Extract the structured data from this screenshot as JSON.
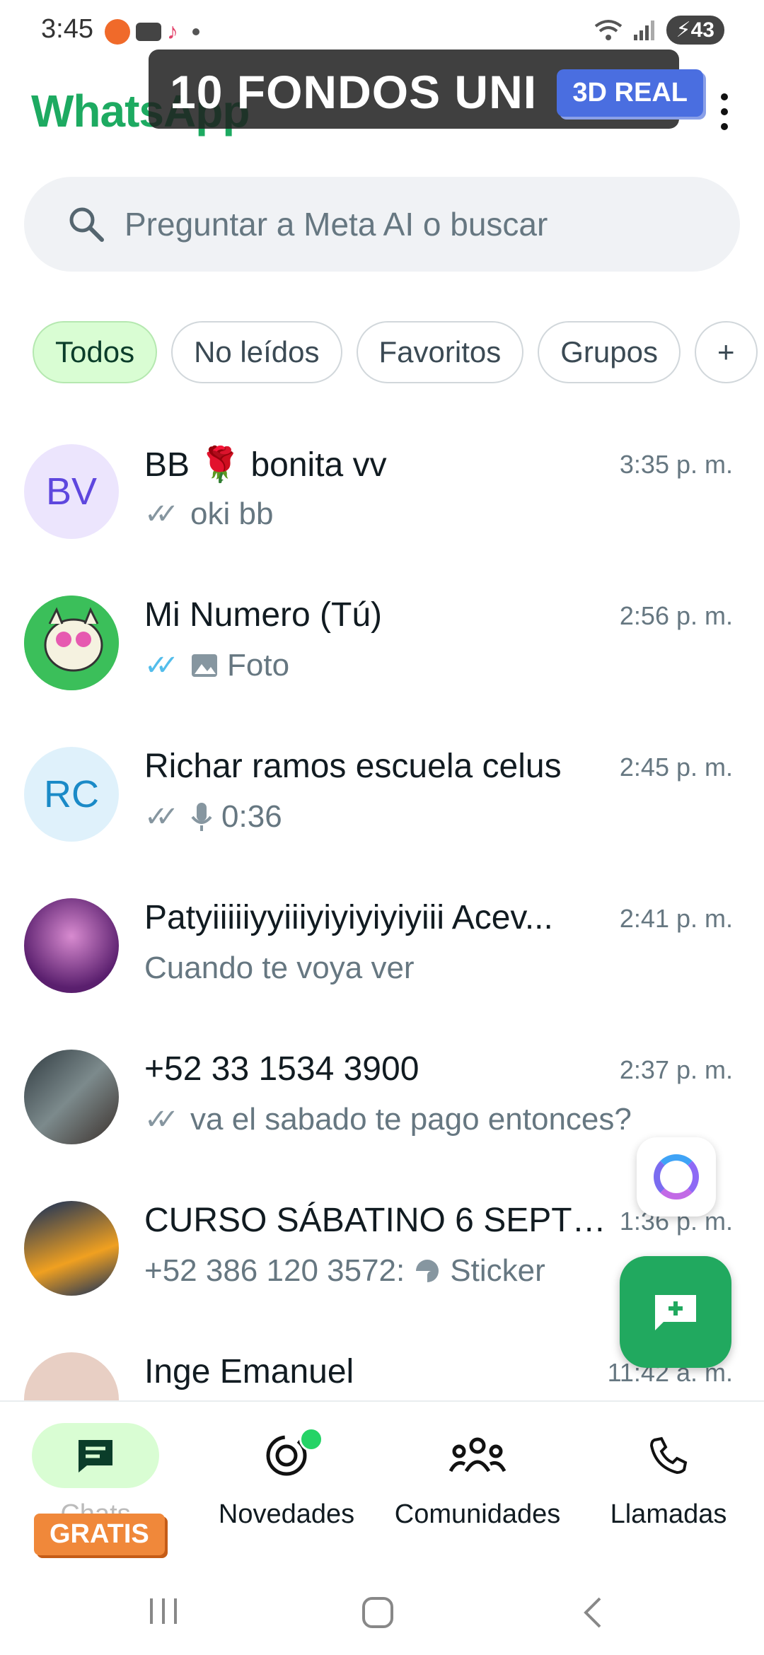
{
  "status_bar": {
    "time": "3:45",
    "battery": "43"
  },
  "header": {
    "title": "WhatsApp"
  },
  "overlay": {
    "text": "10 FONDOS UNI",
    "badge": "3D REAL"
  },
  "search": {
    "placeholder": "Preguntar a Meta AI o buscar"
  },
  "filters": [
    {
      "label": "Todos",
      "active": true
    },
    {
      "label": "No leídos"
    },
    {
      "label": "Favoritos"
    },
    {
      "label": "Grupos"
    },
    {
      "label": "+"
    }
  ],
  "chats": [
    {
      "name": "BB 🌹 bonita vv",
      "time": "3:35 p. m.",
      "initials": "BV",
      "preview": "oki bb",
      "ticks": "grey"
    },
    {
      "name": "Mi Numero (Tú)",
      "time": "2:56 p. m.",
      "preview": "Foto",
      "ticks": "blue",
      "preview_icon": "image-icon"
    },
    {
      "name": "Richar ramos escuela celus",
      "time": "2:45 p. m.",
      "initials": "RC",
      "preview": "0:36",
      "ticks": "grey",
      "preview_icon": "mic-icon"
    },
    {
      "name": "Patyiiiiiyyiiiyiyiyiyiyiii Acev...",
      "time": "2:41 p. m.",
      "preview": "Cuando te voya ver"
    },
    {
      "name": "+52 33 1534 3900",
      "time": "2:37 p. m.",
      "preview": "va el sabado te pago entonces?",
      "ticks": "grey"
    },
    {
      "name": "CURSO SÁBATINO 6 SEPTIE...",
      "time": "1:36 p. m.",
      "preview_sender": "+52 386 120 3572:",
      "preview": "Sticker",
      "preview_icon": "sticker-icon"
    },
    {
      "name": "Inge Emanuel",
      "time": "11:42 a. m."
    }
  ],
  "bottom_nav": [
    {
      "label": "Chats",
      "icon": "chat-icon",
      "active": true
    },
    {
      "label": "Novedades",
      "icon": "status-icon"
    },
    {
      "label": "Comunidades",
      "icon": "communities-icon"
    },
    {
      "label": "Llamadas",
      "icon": "phone-icon"
    }
  ],
  "promo": {
    "badge": "GRATIS"
  },
  "colors": {
    "brand": "#1daa61",
    "fab": "#21a95f",
    "active_chip": "#d9fdd3",
    "read_ticks": "#53bdeb"
  }
}
